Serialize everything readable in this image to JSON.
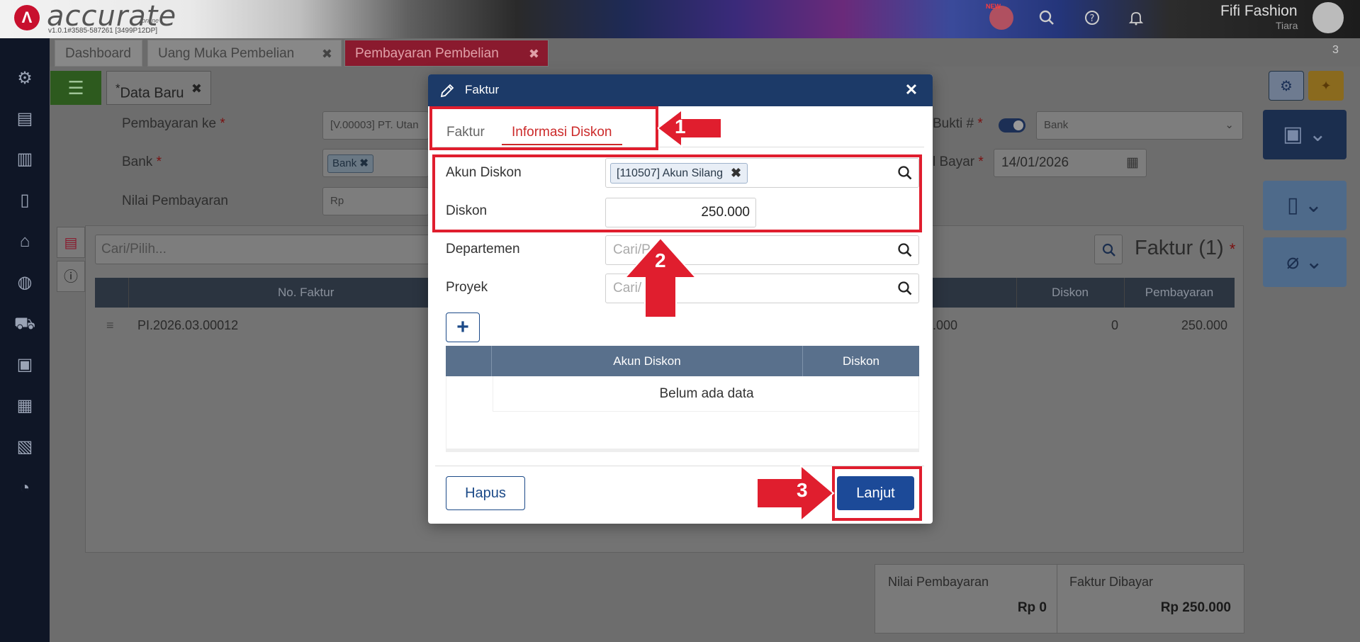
{
  "app": {
    "brand": "accurate",
    "brand_sub": "online",
    "version": "v1.0.1#3585-587261 [3499P12DP]",
    "new_badge": "NEW",
    "company": "Fifi Fashion",
    "user": "Tiara",
    "tab_count": "3"
  },
  "tabs": [
    {
      "label": "Dashboard"
    },
    {
      "label": "Uang Muka Pembelian",
      "close": "✖"
    },
    {
      "label": "Pembayaran Pembelian",
      "close": "✖"
    }
  ],
  "form": {
    "doc_tab": "Data Baru",
    "doc_tab_mark": "*",
    "doc_tab_close": "✖",
    "pembayaran_ke_label": "Pembayaran ke",
    "pembayaran_ke_value": "[V.00003] PT. Utan",
    "bank_label": "Bank",
    "bank_chip": "Bank",
    "bank_chip_close": "✖",
    "nilai_label": "Nilai Pembayaran",
    "nilai_placeholder": "Rp",
    "bukti_label": "Bukti #",
    "bukti_value": "Bank",
    "tgl_label": "l Bayar",
    "tgl_value": "14/01/2026",
    "required_mark": "*"
  },
  "grid": {
    "search_placeholder": "Cari/Pilih...",
    "title": "Faktur (1)",
    "required_mark": "*",
    "headers": {
      "no_faktur": "No. Faktur",
      "diskon": "Diskon",
      "pembayaran": "Pembayaran"
    },
    "row": {
      "no_faktur": "PI.2026.03.00012",
      "partial": ".000",
      "diskon": "0",
      "pembayaran": "250.000"
    }
  },
  "summary": {
    "nilai_label": "Nilai Pembayaran",
    "nilai_value": "Rp 0",
    "faktur_label": "Faktur Dibayar",
    "faktur_value": "Rp 250.000"
  },
  "modal": {
    "title": "Faktur",
    "close": "✕",
    "tabs": [
      "Faktur",
      "Informasi Diskon"
    ],
    "akun_diskon_label": "Akun Diskon",
    "akun_diskon_chip": "[110507] Akun Silang",
    "chip_close": "✖",
    "diskon_label": "Diskon",
    "diskon_value": "250.000",
    "departemen_label": "Departemen",
    "departemen_placeholder": "Cari/P",
    "proyek_label": "Proyek",
    "proyek_placeholder": "Cari/",
    "add_label": "+",
    "table_headers": [
      "Akun Diskon",
      "Diskon"
    ],
    "empty_text": "Belum ada data",
    "hapus": "Hapus",
    "lanjut": "Lanjut"
  },
  "annotations": {
    "step1": "1",
    "step2": "2",
    "step3": "3",
    "color": "#e01e2e"
  }
}
